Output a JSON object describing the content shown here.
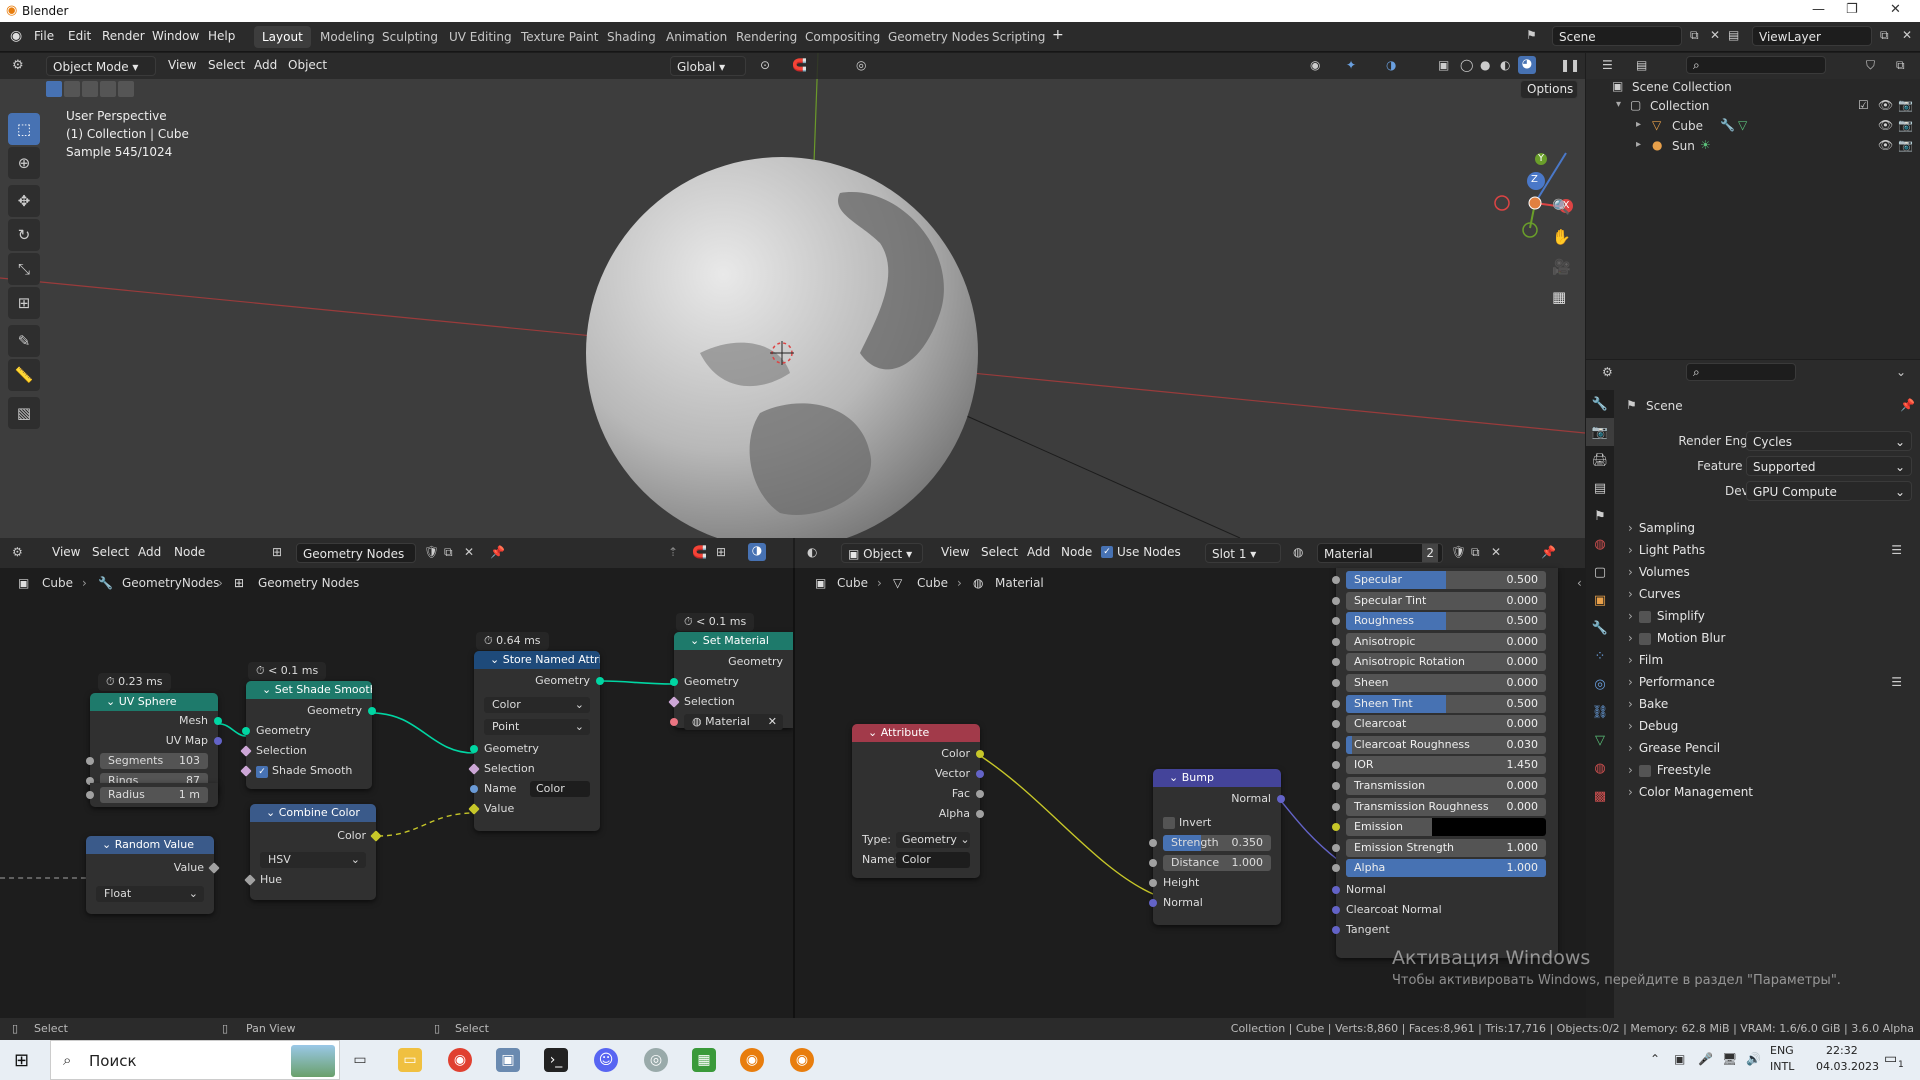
{
  "window": {
    "title": "Blender"
  },
  "topbar": {
    "menus": [
      "File",
      "Edit",
      "Render",
      "Window",
      "Help"
    ],
    "workspaces": [
      "Layout",
      "Modeling",
      "Sculpting",
      "UV Editing",
      "Texture Paint",
      "Shading",
      "Animation",
      "Rendering",
      "Compositing",
      "Geometry Nodes",
      "Scripting"
    ],
    "active_workspace": "Layout",
    "add_tab": "+",
    "scene": "Scene",
    "view_layer": "ViewLayer"
  },
  "viewport": {
    "mode": "Object Mode",
    "menus": [
      "View",
      "Select",
      "Add",
      "Object"
    ],
    "transform_orientation": "Global",
    "options_label": "Options",
    "overlay_lines": [
      "User Perspective",
      "(1) Collection | Cube",
      "Sample 545/1024"
    ],
    "gizmo_axes": {
      "x": "X",
      "y": "Y",
      "z": "Z"
    }
  },
  "outliner": {
    "root": "Scene Collection",
    "collection": "Collection",
    "items": [
      "Cube",
      "Sun"
    ]
  },
  "properties": {
    "scene_label": "Scene",
    "render_engine_label": "Render Engine",
    "render_engine": "Cycles",
    "feature_set_label": "Feature Set",
    "feature_set": "Supported",
    "device_label": "Device",
    "device": "GPU Compute",
    "panels": [
      "Sampling",
      "Light Paths",
      "Volumes",
      "Curves",
      "Simplify",
      "Motion Blur",
      "Film",
      "Performance",
      "Bake",
      "Debug",
      "Grease Pencil",
      "Freestyle",
      "Color Management"
    ]
  },
  "geo_editor": {
    "menus": [
      "View",
      "Select",
      "Add",
      "Node"
    ],
    "tree_name": "Geometry Nodes",
    "breadcrumb": [
      "Cube",
      "GeometryNodes",
      "Geometry Nodes"
    ],
    "nodes": {
      "uv_sphere": {
        "timing": "0.23 ms",
        "title": "UV Sphere",
        "out_mesh": "Mesh",
        "out_uvmap": "UV Map",
        "segments_label": "Segments",
        "segments": "103",
        "rings_label": "Rings",
        "rings": "87",
        "radius_label": "Radius",
        "radius": "1 m"
      },
      "random_value": {
        "title": "Random Value",
        "out_value": "Value",
        "type": "Float"
      },
      "set_shade_smooth": {
        "timing": "< 0.1 ms",
        "title": "Set Shade Smooth",
        "out_geometry": "Geometry",
        "in_geometry": "Geometry",
        "in_selection": "Selection",
        "shade_smooth": "Shade Smooth"
      },
      "combine_color": {
        "title": "Combine Color",
        "out_color": "Color",
        "mode": "HSV",
        "in_hue": "Hue"
      },
      "store_named": {
        "timing": "0.64 ms",
        "title": "Store Named Attribute",
        "out_geometry": "Geometry",
        "data_type": "Color",
        "domain": "Point",
        "in_geometry": "Geometry",
        "in_selection": "Selection",
        "name_label": "Name",
        "name_value": "Color",
        "in_value": "Value"
      },
      "set_material": {
        "timing": "< 0.1 ms",
        "title": "Set Material",
        "out_geometry": "Geometry",
        "in_geometry": "Geometry",
        "in_selection": "Selection",
        "material": "Material"
      }
    }
  },
  "shader_editor": {
    "object_label": "Object",
    "menus": [
      "View",
      "Select",
      "Add",
      "Node"
    ],
    "use_nodes": "Use Nodes",
    "slot": "Slot 1",
    "material_name": "Material",
    "users": "2",
    "breadcrumb": [
      "Cube",
      "Cube",
      "Material"
    ],
    "attribute": {
      "title": "Attribute",
      "outputs": [
        "Color",
        "Vector",
        "Fac",
        "Alpha"
      ],
      "type_label": "Type:",
      "type_value": "Geometry",
      "name_label": "Name:",
      "name_value": "Color"
    },
    "bump": {
      "title": "Bump",
      "out_normal": "Normal",
      "invert": "Invert",
      "strength_label": "Strength",
      "strength": "0.350",
      "distance_label": "Distance",
      "distance": "1.000",
      "in_height": "Height",
      "in_normal": "Normal"
    },
    "bsdf_rows": [
      {
        "label": "Specular",
        "value": "0.500",
        "fill": 0.5
      },
      {
        "label": "Specular Tint",
        "value": "0.000",
        "fill": 0
      },
      {
        "label": "Roughness",
        "value": "0.500",
        "fill": 0.5
      },
      {
        "label": "Anisotropic",
        "value": "0.000",
        "fill": 0
      },
      {
        "label": "Anisotropic Rotation",
        "value": "0.000",
        "fill": 0
      },
      {
        "label": "Sheen",
        "value": "0.000",
        "fill": 0
      },
      {
        "label": "Sheen Tint",
        "value": "0.500",
        "fill": 0.5
      },
      {
        "label": "Clearcoat",
        "value": "0.000",
        "fill": 0
      },
      {
        "label": "Clearcoat Roughness",
        "value": "0.030",
        "fill": 0.03
      },
      {
        "label": "IOR",
        "value": "1.450",
        "fill": 0
      },
      {
        "label": "Transmission",
        "value": "0.000",
        "fill": 0
      },
      {
        "label": "Transmission Roughness",
        "value": "0.000",
        "fill": 0
      },
      {
        "label": "Emission",
        "value": "",
        "fill": 0
      },
      {
        "label": "Emission Strength",
        "value": "1.000",
        "fill": 0
      },
      {
        "label": "Alpha",
        "value": "1.000",
        "fill": 1
      }
    ],
    "bsdf_inputs": [
      "Normal",
      "Clearcoat Normal",
      "Tangent"
    ]
  },
  "watermark": {
    "line1": "Активация Windows",
    "line2": "Чтобы активировать Windows, перейдите в раздел \"Параметры\"."
  },
  "statusbar": {
    "left1": "Select",
    "left2": "Pan View",
    "left3": "Select",
    "stats": "Collection | Cube | Verts:8,860 | Faces:8,961 | Tris:17,716 | Objects:0/2 | Memory: 62.8 MiB | VRAM: 1.6/6.0 GiB | 3.6.0 Alpha"
  },
  "taskbar": {
    "search_placeholder": "Поиск",
    "lang1": "ENG",
    "lang2": "INTL",
    "time": "22:32",
    "date": "04.03.2023",
    "notif_count": "1"
  }
}
